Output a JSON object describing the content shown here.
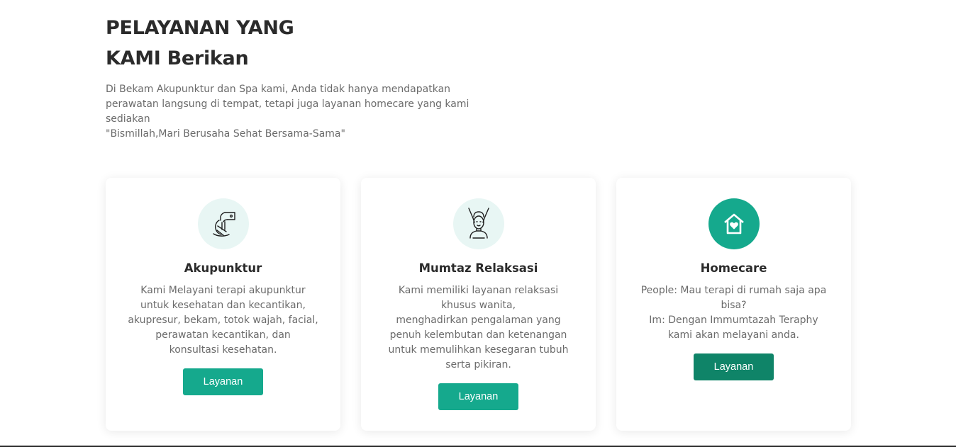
{
  "section": {
    "title_lines": [
      "PELAYANAN YANG",
      "KAMI Berikan"
    ],
    "description_lines": [
      "Di Bekam Akupunktur dan Spa kami, Anda tidak hanya mendapatkan",
      "perawatan langsung di tempat, tetapi juga layanan homecare yang kami",
      "sediakan",
      "\"Bismillah,Mari Berusaha Sehat Bersama-Sama\""
    ]
  },
  "cards": [
    {
      "icon": "acupuncture-hand-icon",
      "title": "Akupunktur",
      "text_lines": [
        "Kami Melayani terapi akupunktur",
        "untuk kesehatan dan kecantikan,",
        "akupresur, bekam, totok wajah, facial,",
        "perawatan kecantikan, dan",
        "konsultasi kesehatan."
      ],
      "button_label": "Layanan"
    },
    {
      "icon": "massage-relaxation-icon",
      "title": "Mumtaz Relaksasi",
      "text_lines": [
        "Kami memiliki layanan relaksasi",
        "khusus wanita,",
        "menghadirkan pengalaman yang",
        "penuh kelembutan dan ketenangan",
        "untuk memulihkan kesegaran tubuh",
        "serta pikiran."
      ],
      "button_label": "Layanan"
    },
    {
      "icon": "home-heart-icon",
      "title": "Homecare",
      "text_lines": [
        "People: Mau terapi di rumah saja apa",
        "bisa?",
        "Im: Dengan Immumtazah Teraphy",
        "kami akan melayani anda."
      ],
      "button_label": "Layanan"
    }
  ],
  "colors": {
    "accent": "#15a98d",
    "accent_dark": "#0f8468",
    "icon_bg": "#e8f6f4",
    "heading": "#2b2b2b",
    "body_text": "#6b6b6b"
  }
}
